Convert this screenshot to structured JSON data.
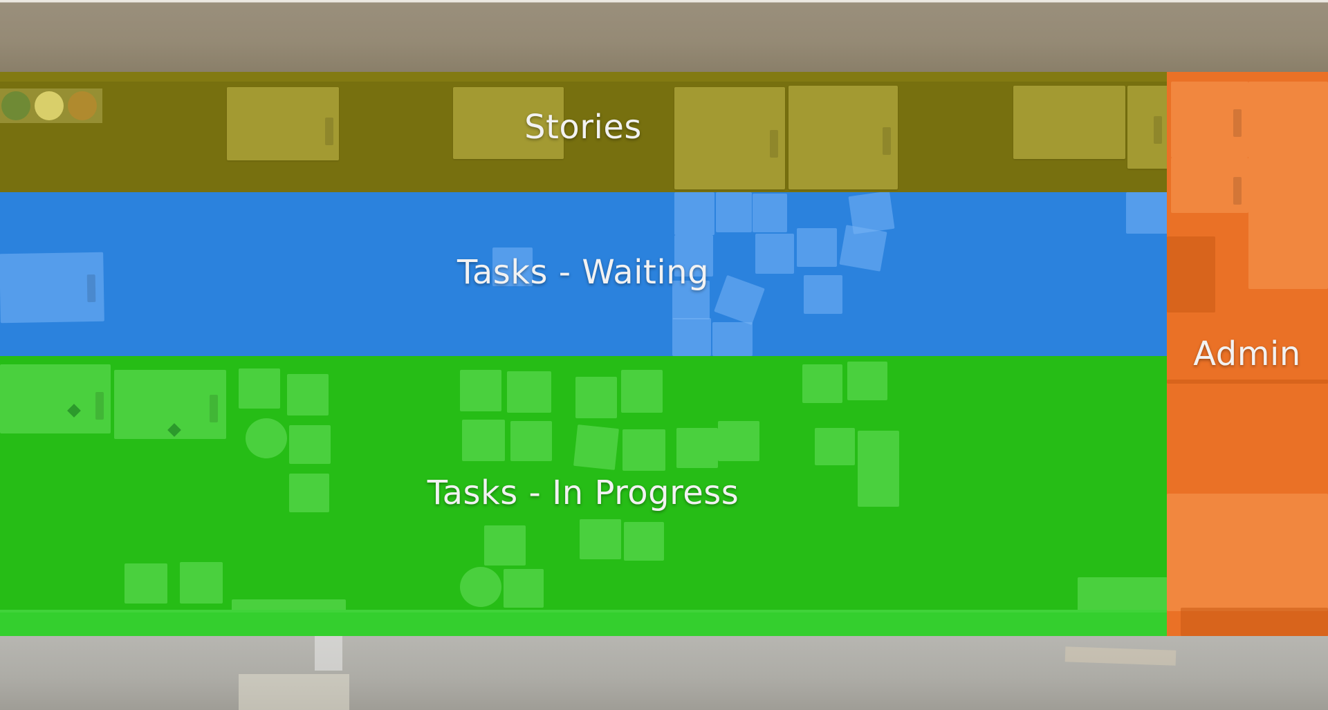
{
  "lanes": {
    "stories": {
      "label": "Stories",
      "color": "#77700f"
    },
    "waiting": {
      "label": "Tasks - Waiting",
      "color": "#2b82dd"
    },
    "in_progress": {
      "label": "Tasks - In Progress",
      "color": "#26bd16"
    },
    "admin": {
      "label": "Admin",
      "color": "#ea7126"
    }
  },
  "mood_icons": [
    "frown-face-icon",
    "neutral-face-icon",
    "smile-face-icon"
  ]
}
